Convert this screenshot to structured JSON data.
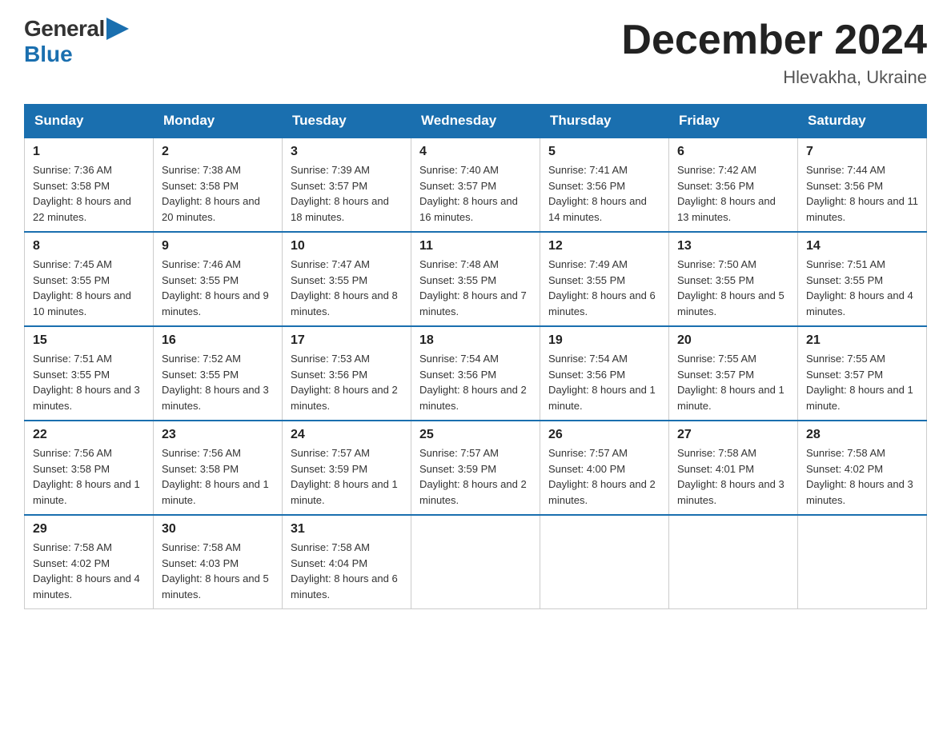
{
  "header": {
    "logo_general": "General",
    "logo_blue": "Blue",
    "month_title": "December 2024",
    "location": "Hlevakha, Ukraine"
  },
  "days_of_week": [
    "Sunday",
    "Monday",
    "Tuesday",
    "Wednesday",
    "Thursday",
    "Friday",
    "Saturday"
  ],
  "weeks": [
    [
      {
        "day": "1",
        "sunrise": "7:36 AM",
        "sunset": "3:58 PM",
        "daylight": "8 hours and 22 minutes."
      },
      {
        "day": "2",
        "sunrise": "7:38 AM",
        "sunset": "3:58 PM",
        "daylight": "8 hours and 20 minutes."
      },
      {
        "day": "3",
        "sunrise": "7:39 AM",
        "sunset": "3:57 PM",
        "daylight": "8 hours and 18 minutes."
      },
      {
        "day": "4",
        "sunrise": "7:40 AM",
        "sunset": "3:57 PM",
        "daylight": "8 hours and 16 minutes."
      },
      {
        "day": "5",
        "sunrise": "7:41 AM",
        "sunset": "3:56 PM",
        "daylight": "8 hours and 14 minutes."
      },
      {
        "day": "6",
        "sunrise": "7:42 AM",
        "sunset": "3:56 PM",
        "daylight": "8 hours and 13 minutes."
      },
      {
        "day": "7",
        "sunrise": "7:44 AM",
        "sunset": "3:56 PM",
        "daylight": "8 hours and 11 minutes."
      }
    ],
    [
      {
        "day": "8",
        "sunrise": "7:45 AM",
        "sunset": "3:55 PM",
        "daylight": "8 hours and 10 minutes."
      },
      {
        "day": "9",
        "sunrise": "7:46 AM",
        "sunset": "3:55 PM",
        "daylight": "8 hours and 9 minutes."
      },
      {
        "day": "10",
        "sunrise": "7:47 AM",
        "sunset": "3:55 PM",
        "daylight": "8 hours and 8 minutes."
      },
      {
        "day": "11",
        "sunrise": "7:48 AM",
        "sunset": "3:55 PM",
        "daylight": "8 hours and 7 minutes."
      },
      {
        "day": "12",
        "sunrise": "7:49 AM",
        "sunset": "3:55 PM",
        "daylight": "8 hours and 6 minutes."
      },
      {
        "day": "13",
        "sunrise": "7:50 AM",
        "sunset": "3:55 PM",
        "daylight": "8 hours and 5 minutes."
      },
      {
        "day": "14",
        "sunrise": "7:51 AM",
        "sunset": "3:55 PM",
        "daylight": "8 hours and 4 minutes."
      }
    ],
    [
      {
        "day": "15",
        "sunrise": "7:51 AM",
        "sunset": "3:55 PM",
        "daylight": "8 hours and 3 minutes."
      },
      {
        "day": "16",
        "sunrise": "7:52 AM",
        "sunset": "3:55 PM",
        "daylight": "8 hours and 3 minutes."
      },
      {
        "day": "17",
        "sunrise": "7:53 AM",
        "sunset": "3:56 PM",
        "daylight": "8 hours and 2 minutes."
      },
      {
        "day": "18",
        "sunrise": "7:54 AM",
        "sunset": "3:56 PM",
        "daylight": "8 hours and 2 minutes."
      },
      {
        "day": "19",
        "sunrise": "7:54 AM",
        "sunset": "3:56 PM",
        "daylight": "8 hours and 1 minute."
      },
      {
        "day": "20",
        "sunrise": "7:55 AM",
        "sunset": "3:57 PM",
        "daylight": "8 hours and 1 minute."
      },
      {
        "day": "21",
        "sunrise": "7:55 AM",
        "sunset": "3:57 PM",
        "daylight": "8 hours and 1 minute."
      }
    ],
    [
      {
        "day": "22",
        "sunrise": "7:56 AM",
        "sunset": "3:58 PM",
        "daylight": "8 hours and 1 minute."
      },
      {
        "day": "23",
        "sunrise": "7:56 AM",
        "sunset": "3:58 PM",
        "daylight": "8 hours and 1 minute."
      },
      {
        "day": "24",
        "sunrise": "7:57 AM",
        "sunset": "3:59 PM",
        "daylight": "8 hours and 1 minute."
      },
      {
        "day": "25",
        "sunrise": "7:57 AM",
        "sunset": "3:59 PM",
        "daylight": "8 hours and 2 minutes."
      },
      {
        "day": "26",
        "sunrise": "7:57 AM",
        "sunset": "4:00 PM",
        "daylight": "8 hours and 2 minutes."
      },
      {
        "day": "27",
        "sunrise": "7:58 AM",
        "sunset": "4:01 PM",
        "daylight": "8 hours and 3 minutes."
      },
      {
        "day": "28",
        "sunrise": "7:58 AM",
        "sunset": "4:02 PM",
        "daylight": "8 hours and 3 minutes."
      }
    ],
    [
      {
        "day": "29",
        "sunrise": "7:58 AM",
        "sunset": "4:02 PM",
        "daylight": "8 hours and 4 minutes."
      },
      {
        "day": "30",
        "sunrise": "7:58 AM",
        "sunset": "4:03 PM",
        "daylight": "8 hours and 5 minutes."
      },
      {
        "day": "31",
        "sunrise": "7:58 AM",
        "sunset": "4:04 PM",
        "daylight": "8 hours and 6 minutes."
      },
      null,
      null,
      null,
      null
    ]
  ]
}
